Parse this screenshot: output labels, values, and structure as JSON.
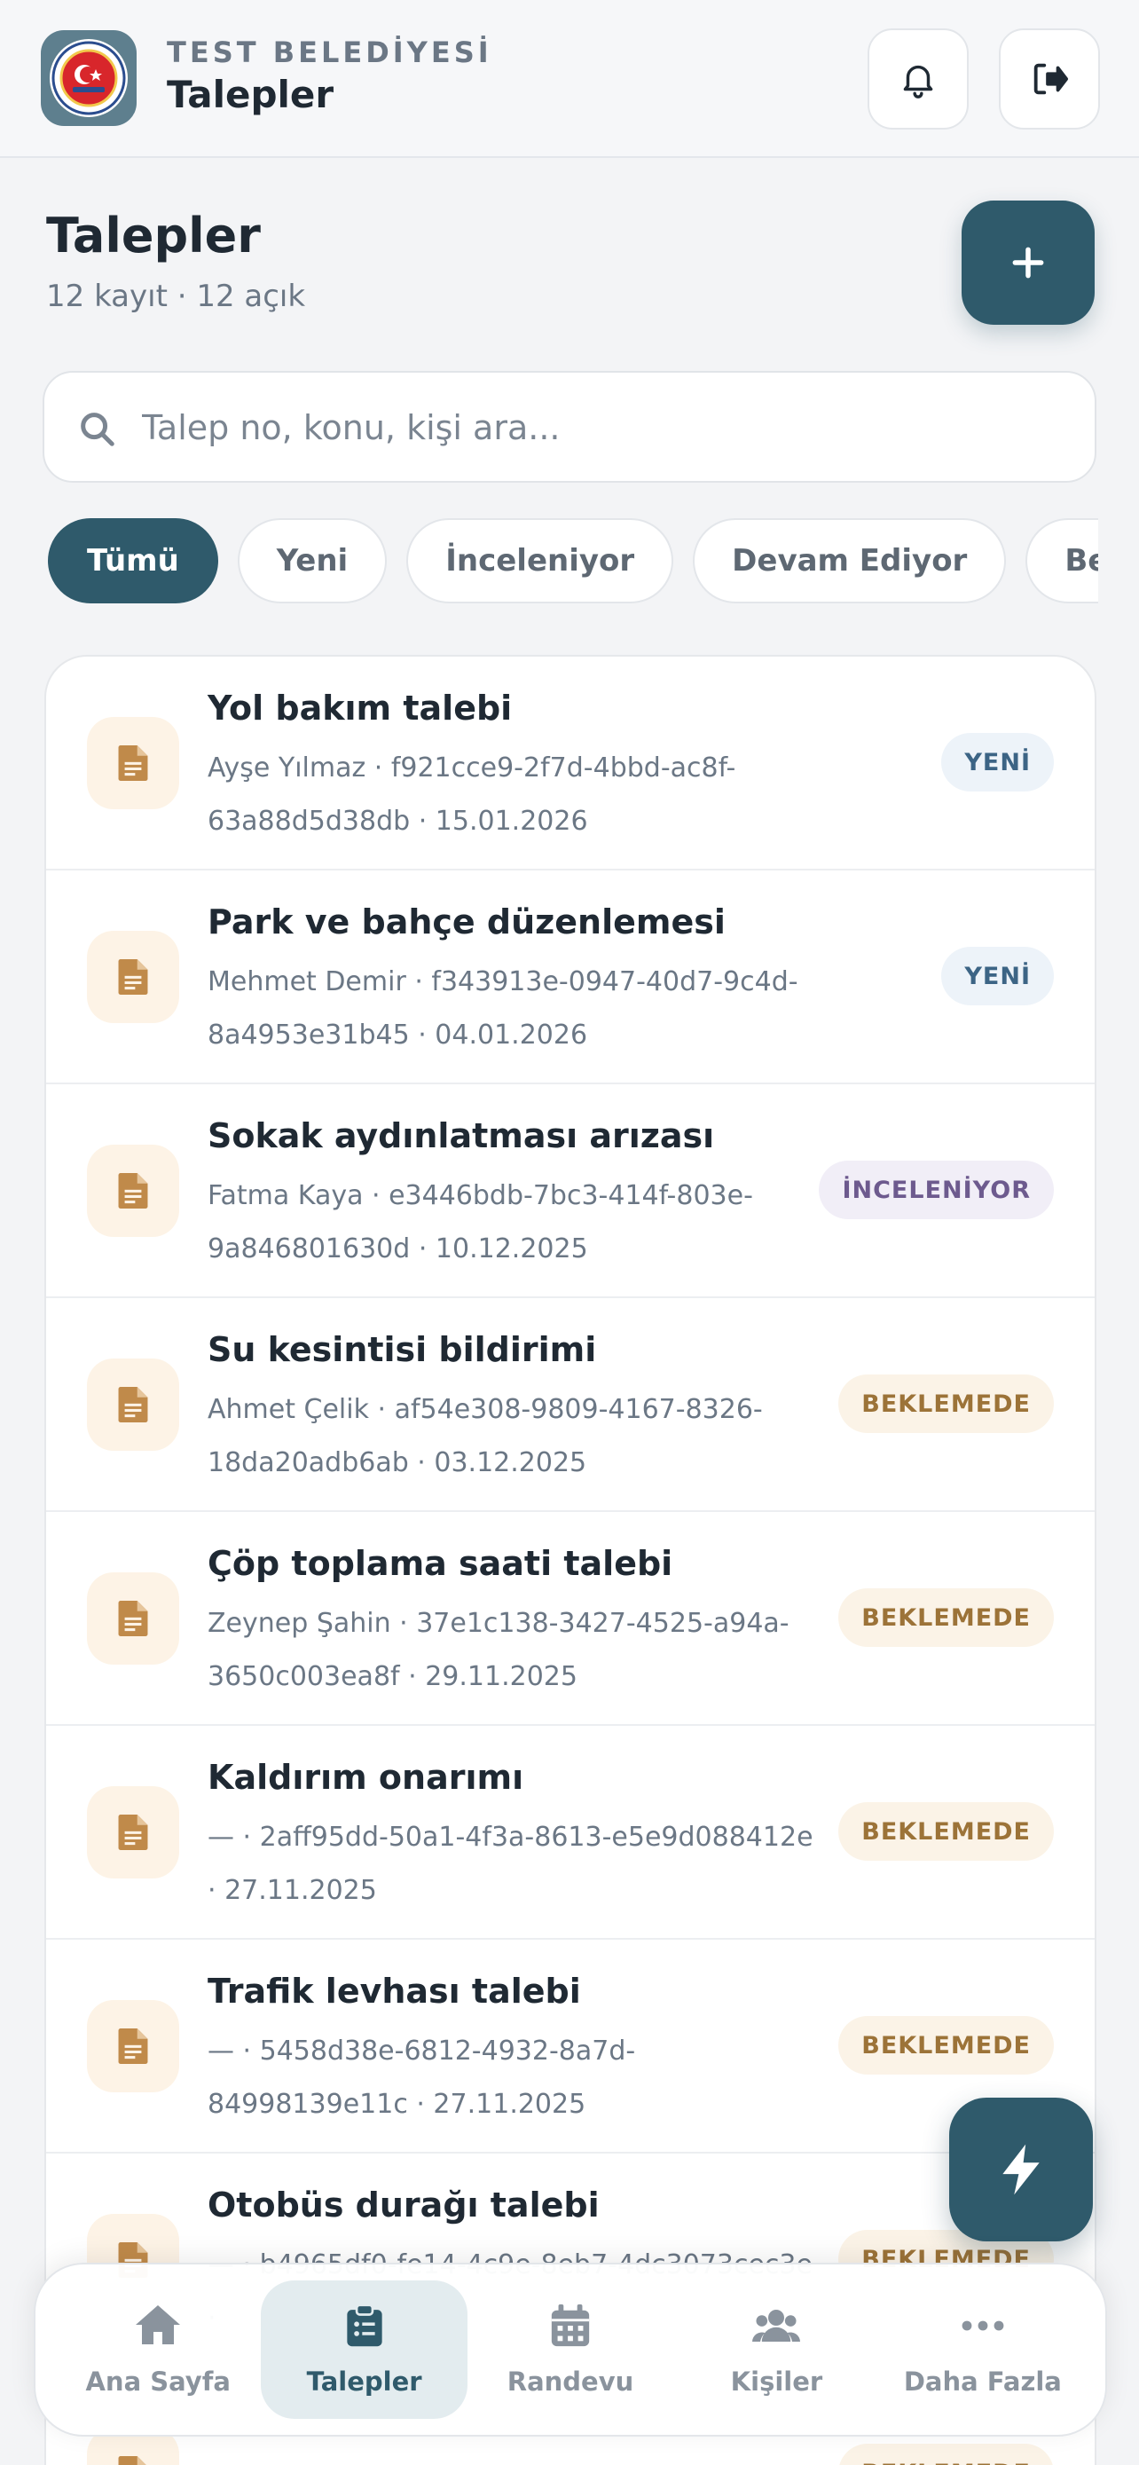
{
  "header": {
    "org_name": "TEST BELEDİYESİ",
    "title": "Talepler",
    "icons": {
      "notifications": "bell-icon",
      "logout": "logout-icon"
    }
  },
  "page": {
    "title": "Talepler",
    "subtitle": "12 kayıt · 12 açık",
    "add_icon": "plus-icon"
  },
  "search": {
    "placeholder": "Talep no, konu, kişi ara...",
    "value": ""
  },
  "filters": [
    {
      "label": "Tümü",
      "active": true
    },
    {
      "label": "Yeni",
      "active": false
    },
    {
      "label": "İnceleniyor",
      "active": false
    },
    {
      "label": "Devam Ediyor",
      "active": false
    },
    {
      "label": "Beklemede",
      "active": false
    }
  ],
  "requests": [
    {
      "title": "Yol bakım talebi",
      "meta": "Ayşe Yılmaz · f921cce9-2f7d-4bbd-ac8f-63a88d5d38db · 15.01.2026",
      "status": "YENİ"
    },
    {
      "title": "Park ve bahçe düzenlemesi",
      "meta": "Mehmet Demir · f343913e-0947-40d7-9c4d-8a4953e31b45 · 04.01.2026",
      "status": "YENİ"
    },
    {
      "title": "Sokak aydınlatması arızası",
      "meta": "Fatma Kaya · e3446bdb-7bc3-414f-803e-9a846801630d · 10.12.2025",
      "status": "İNCELENİYOR"
    },
    {
      "title": "Su kesintisi bildirimi",
      "meta": "Ahmet Çelik · af54e308-9809-4167-8326-18da20adb6ab · 03.12.2025",
      "status": "BEKLEMEDE"
    },
    {
      "title": "Çöp toplama saati talebi",
      "meta": "Zeynep Şahin · 37e1c138-3427-4525-a94a-3650c003ea8f · 29.11.2025",
      "status": "BEKLEMEDE"
    },
    {
      "title": "Kaldırım onarımı",
      "meta": "— · 2aff95dd-50a1-4f3a-8613-e5e9d088412e · 27.11.2025",
      "status": "BEKLEMEDE"
    },
    {
      "title": "Trafik levhası talebi",
      "meta": "— · 5458d38e-6812-4932-8a7d-84998139e11c · 27.11.2025",
      "status": "BEKLEMEDE"
    },
    {
      "title": "Otobüs durağı talebi",
      "meta": "— · b4965df0-fe14-4c9e-8eb7-4dc3073cec3e ·",
      "status": "BEKLEMEDE"
    },
    {
      "title": "",
      "meta": "",
      "status": "BEKLEMEDE"
    }
  ],
  "quick_action_icon": "bolt-icon",
  "bottom_nav": [
    {
      "label": "Ana Sayfa",
      "icon": "home-icon",
      "active": false
    },
    {
      "label": "Talepler",
      "icon": "clipboard-list-icon",
      "active": true
    },
    {
      "label": "Randevu",
      "icon": "calendar-icon",
      "active": false
    },
    {
      "label": "Kişiler",
      "icon": "users-icon",
      "active": false
    },
    {
      "label": "Daha Fazla",
      "icon": "more-icon",
      "active": false
    }
  ],
  "colors": {
    "primary": "#2f5a6b",
    "doc_icon": "#c08a4a",
    "status_new": "#3c6485",
    "status_review": "#6d5a8e",
    "status_wait": "#9c7338"
  }
}
